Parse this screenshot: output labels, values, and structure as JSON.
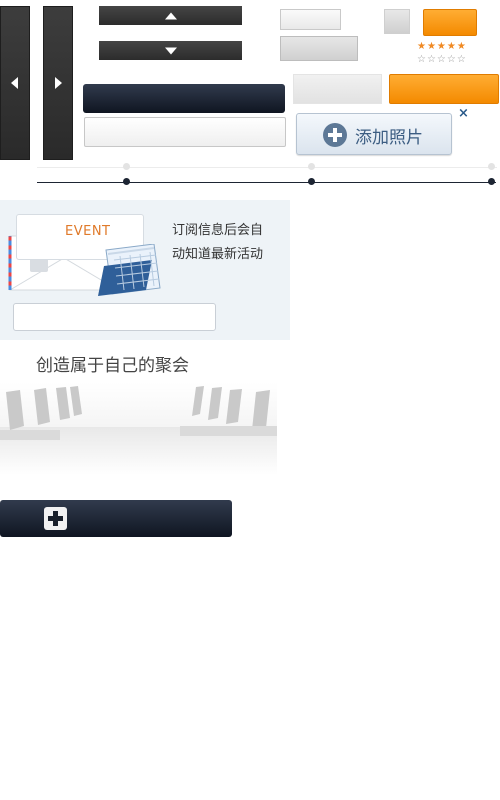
{
  "add_photo": {
    "label": "添加照片",
    "close": "×"
  },
  "event_card": {
    "badge": "EVENT",
    "text_line1": "订阅信息后会自",
    "text_line2": "动知道最新活动",
    "input_placeholder": ""
  },
  "meeting_banner": {
    "title": "创造属于自己的聚会"
  },
  "rating": {
    "rows": [
      {
        "stars": "★★★★★",
        "filled": 5,
        "max": 5,
        "color": "#f08a24"
      },
      {
        "stars": "☆☆☆☆☆",
        "filled": 0,
        "max": 5,
        "color": "#9a9a9a"
      }
    ]
  },
  "colors": {
    "accent_orange": "#f48a00",
    "navy": "#1d2533",
    "link_blue": "#3c5d82"
  },
  "icons": [
    "arrow-left-icon",
    "arrow-right-icon",
    "caret-up-icon",
    "caret-down-icon",
    "plus-circle-icon",
    "close-icon",
    "calendar-icon",
    "envelope-icon",
    "plus-icon"
  ]
}
